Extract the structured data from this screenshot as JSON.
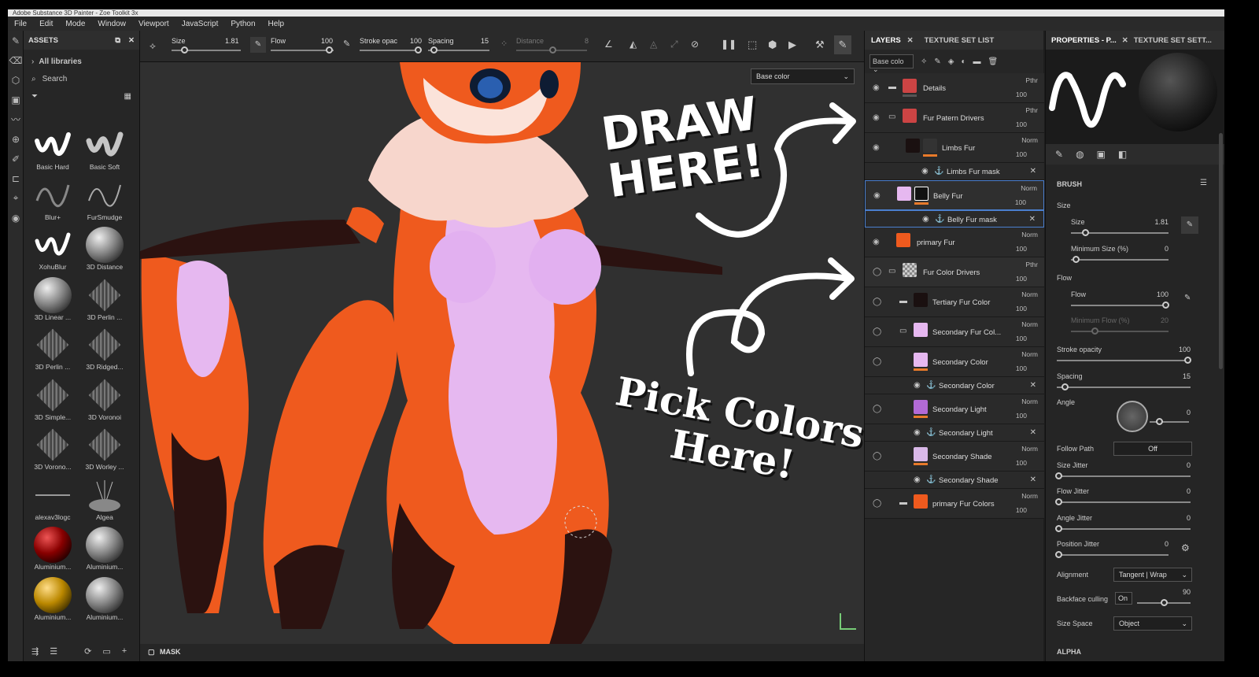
{
  "titlebar": "Adobe Substance 3D Painter - Zoe Toolkit 3x",
  "menu": [
    "File",
    "Edit",
    "Mode",
    "Window",
    "Viewport",
    "JavaScript",
    "Python",
    "Help"
  ],
  "assets": {
    "title": "ASSETS",
    "libraries": "All libraries",
    "search_placeholder": "Search",
    "items": [
      "Basic Hard",
      "Basic Soft",
      "Blur+",
      "FurSmudge",
      "XohuBlur",
      "3D Distance",
      "3D Linear ...",
      "3D Perlin ...",
      "3D Perlin ...",
      "3D Ridged...",
      "3D Simple...",
      "3D Voronoi",
      "3D Vorono...",
      "3D Worley ...",
      "alexav3logc",
      "Algea",
      "Aluminium...",
      "Aluminium...",
      "Aluminium...",
      "Aluminium..."
    ]
  },
  "toolbar": {
    "size_label": "Size",
    "size_value": "1.81",
    "flow_label": "Flow",
    "flow_value": "100",
    "stroke_label": "Stroke opac",
    "stroke_value": "100",
    "spacing_label": "Spacing",
    "spacing_value": "15",
    "distance_label": "Distance",
    "distance_value": "8"
  },
  "viewport": {
    "channel": "Base color",
    "annot1_line1": "DRAW",
    "annot1_line2": "HERE!",
    "annot2_line1": "Pick Colors",
    "annot2_line2": "Here!",
    "mask_label": "MASK"
  },
  "layers": {
    "tab1": "LAYERS",
    "tab2": "TEXTURE SET LIST",
    "channel": "Base colo",
    "rows": [
      {
        "name": "Details",
        "blend": "Pthr",
        "opacity": "100"
      },
      {
        "name": "Fur Patern Drivers",
        "blend": "Pthr",
        "opacity": "100"
      },
      {
        "name": "Limbs Fur",
        "blend": "Norm",
        "opacity": "100"
      },
      {
        "name": "Limbs Fur mask"
      },
      {
        "name": "Belly Fur",
        "blend": "Norm",
        "opacity": "100"
      },
      {
        "name": "Belly Fur mask"
      },
      {
        "name": "primary Fur",
        "blend": "Norm",
        "opacity": "100"
      },
      {
        "name": "Fur Color Drivers",
        "blend": "Pthr",
        "opacity": "100"
      },
      {
        "name": "Tertiary Fur Color",
        "blend": "Norm",
        "opacity": "100"
      },
      {
        "name": "Secondary Fur Col...",
        "blend": "Norm",
        "opacity": "100"
      },
      {
        "name": "Secondary Color",
        "blend": "Norm",
        "opacity": "100"
      },
      {
        "name": "Secondary Color"
      },
      {
        "name": "Secondary Light",
        "blend": "Norm",
        "opacity": "100"
      },
      {
        "name": "Secondary Light"
      },
      {
        "name": "Secondary Shade",
        "blend": "Norm",
        "opacity": "100"
      },
      {
        "name": "Secondary Shade"
      },
      {
        "name": "primary Fur Colors",
        "blend": "Norm",
        "opacity": "100"
      }
    ]
  },
  "props": {
    "tab1": "PROPERTIES - P...",
    "tab2": "TEXTURE SET SETT...",
    "brush": "BRUSH",
    "size": "Size",
    "size_inner": "Size",
    "size_value": "1.81",
    "minsize": "Minimum Size (%)",
    "minsize_value": "0",
    "flow": "Flow",
    "flow_inner": "Flow",
    "flow_value": "100",
    "minflow": "Minimum Flow (%)",
    "minflow_value": "20",
    "stroke": "Stroke opacity",
    "stroke_value": "100",
    "spacing": "Spacing",
    "spacing_value": "15",
    "angle": "Angle",
    "angle_value": "0",
    "followpath": "Follow Path",
    "followpath_value": "Off",
    "sizejitter": "Size Jitter",
    "sizejitter_value": "0",
    "flowjitter": "Flow Jitter",
    "flowjitter_value": "0",
    "anglejitter": "Angle Jitter",
    "anglejitter_value": "0",
    "posjitter": "Position Jitter",
    "posjitter_value": "0",
    "alignment": "Alignment",
    "alignment_value": "Tangent | Wrap",
    "backface": "Backface culling",
    "backface_value": "On",
    "backface_angle": "90",
    "sizespace": "Size Space",
    "sizespace_value": "Object",
    "alpha": "ALPHA"
  },
  "colors": {
    "accent": "#e87a2a",
    "selection": "#4a7fcf",
    "fur_orange": "#ef5a1e",
    "belly": "#e6b8f0"
  }
}
